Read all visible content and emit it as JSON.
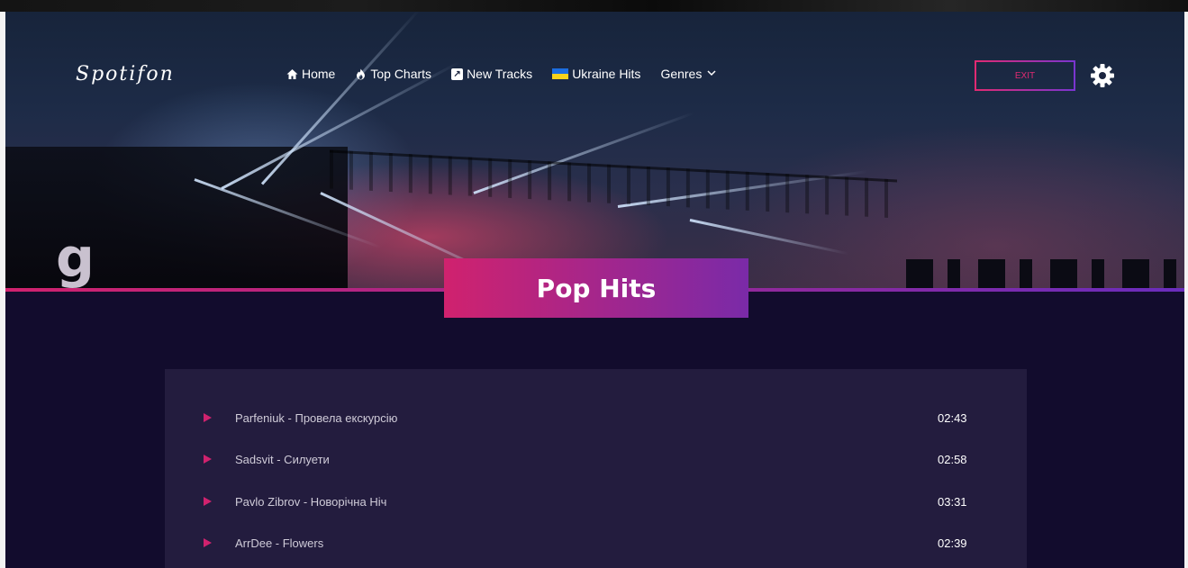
{
  "app": {
    "logo": "Spotifon"
  },
  "nav": {
    "items": [
      {
        "label": "Home",
        "icon": "home-icon"
      },
      {
        "label": "Top Charts",
        "icon": "fire-icon"
      },
      {
        "label": "New Tracks",
        "icon": "external-link-icon"
      },
      {
        "label": "Ukraine Hits",
        "icon": "ukraine-flag-icon"
      },
      {
        "label": "Genres",
        "icon": "chevron-down-icon"
      }
    ]
  },
  "header": {
    "exit_label": "EXIT",
    "settings_icon": "gear-icon"
  },
  "page": {
    "title": "Pop Hits"
  },
  "tracks": [
    {
      "title": "Parfeniuk - Провела екскурсію",
      "duration": "02:43"
    },
    {
      "title": "Sadsvit - Силуети",
      "duration": "02:58"
    },
    {
      "title": "Pavlo Zibrov - Новорічна Ніч",
      "duration": "03:31"
    },
    {
      "title": "ArrDee - Flowers",
      "duration": "02:39"
    }
  ],
  "colors": {
    "accent_pink": "#d0226e",
    "accent_purple": "#7a35d0",
    "panel_bg": "#231c3e",
    "page_bg": "#120c2d"
  }
}
